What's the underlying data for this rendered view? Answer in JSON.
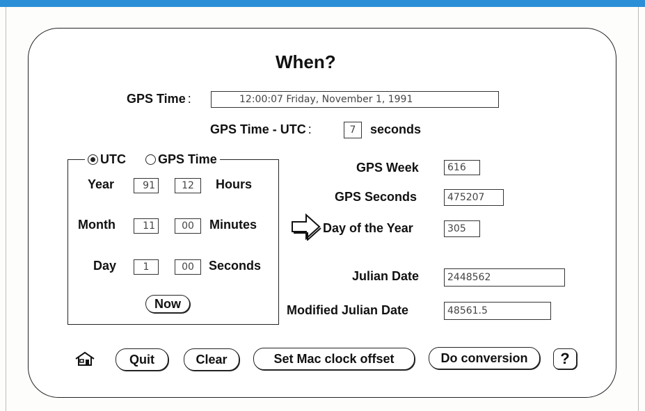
{
  "title": "When?",
  "gps_time": {
    "label": "GPS Time",
    "colon": ":",
    "value": "12:00:07  Friday, November 1, 1991"
  },
  "offset": {
    "label": "GPS Time - UTC",
    "colon": ":",
    "value": "7",
    "unit": "seconds"
  },
  "mode": {
    "options": [
      {
        "label": "UTC",
        "selected": true
      },
      {
        "label": "GPS Time",
        "selected": false
      }
    ]
  },
  "date_fields": {
    "year": {
      "label": "Year",
      "value": "91"
    },
    "month": {
      "label": "Month",
      "value": "11"
    },
    "day": {
      "label": "Day",
      "value": "1"
    },
    "hours": {
      "label": "Hours",
      "value": "12"
    },
    "minutes": {
      "label": "Minutes",
      "value": "00"
    },
    "seconds": {
      "label": "Seconds",
      "value": "00"
    }
  },
  "now_button": "Now",
  "results": {
    "gps_week": {
      "label": "GPS Week",
      "value": "616"
    },
    "gps_seconds": {
      "label": "GPS Seconds",
      "value": "475207"
    },
    "day_of_year": {
      "label": "Day of the Year",
      "value": "305"
    },
    "julian_date": {
      "label": "Julian Date",
      "value": "2448562"
    },
    "modified_julian_date": {
      "label": "Modified Julian Date",
      "value": "48561.5"
    }
  },
  "toolbar": {
    "home_icon": "home-icon",
    "quit": "Quit",
    "clear": "Clear",
    "set_clock": "Set Mac clock offset",
    "do_conversion": "Do conversion",
    "help": "?"
  },
  "colors": {
    "accent_bar": "#2a8fd6"
  }
}
